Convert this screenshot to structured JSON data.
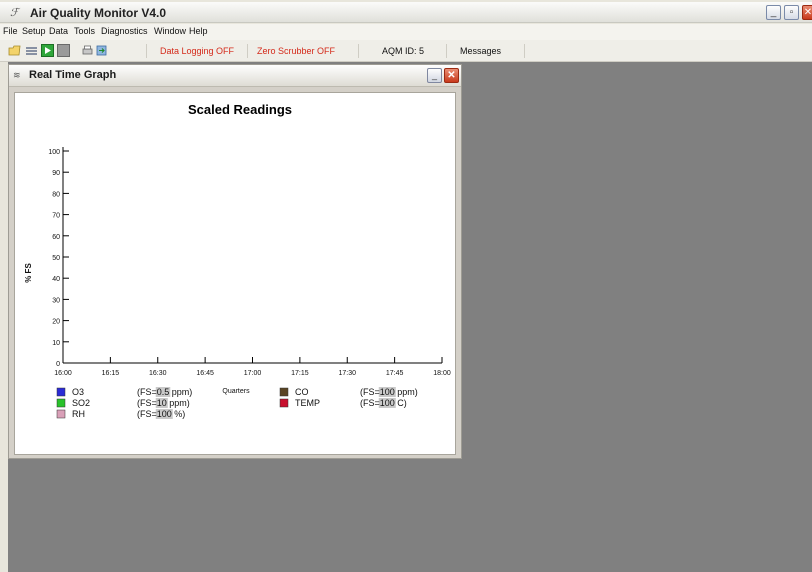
{
  "window": {
    "title": "Air Quality Monitor V4.0",
    "icon": "app-icon",
    "controls": {
      "minimize": "_",
      "restore": "▫",
      "close": "✕"
    }
  },
  "menu": [
    "File",
    "Setup",
    "Data",
    "Tools",
    "Diagnostics",
    "Window",
    "Help"
  ],
  "toolbar": {
    "icons": [
      "open-folder-icon",
      "graph-icon",
      "play-icon",
      "stop-icon",
      "print-icon",
      "export-icon"
    ],
    "data_logging": "Data Logging OFF",
    "zero_scrubber": "Zero Scrubber OFF",
    "aqm_id": "AQM ID: 5",
    "messages": "Messages",
    "colors": {
      "status_red": "#d42a1a"
    }
  },
  "child_window": {
    "title": "Real Time Graph",
    "controls": {
      "minimize": "_",
      "close": "✕"
    }
  },
  "chart_data": {
    "type": "line",
    "title": "Scaled Readings",
    "xlabel": "Quarters",
    "ylabel": "% FS",
    "x_ticks": [
      "16:00",
      "16:15",
      "16:30",
      "16:45",
      "17:00",
      "17:15",
      "17:30",
      "17:45",
      "18:00"
    ],
    "y_ticks": [
      "0",
      "10",
      "20",
      "30",
      "40",
      "50",
      "60",
      "70",
      "80",
      "90",
      "100"
    ],
    "ylim": [
      0,
      100
    ],
    "grid": false,
    "series": [
      {
        "name": "O3",
        "color": "#2b2bd6",
        "fs_prefix": "(FS=",
        "fs_value": "0.5",
        "fs_unit": " ppm)",
        "values": []
      },
      {
        "name": "SO2",
        "color": "#29c22b",
        "fs_prefix": "(FS=",
        "fs_value": "10",
        "fs_unit": " ppm)",
        "values": []
      },
      {
        "name": "RH",
        "color": "#d9a0b8",
        "fs_prefix": "(FS=",
        "fs_value": "100",
        "fs_unit": " %)",
        "values": []
      },
      {
        "name": "CO",
        "color": "#5a4424",
        "fs_prefix": "(FS=",
        "fs_value": "100",
        "fs_unit": " ppm)",
        "values": []
      },
      {
        "name": "TEMP",
        "color": "#c8102e",
        "fs_prefix": "(FS=",
        "fs_value": "100",
        "fs_unit": " C)",
        "values": []
      }
    ]
  }
}
